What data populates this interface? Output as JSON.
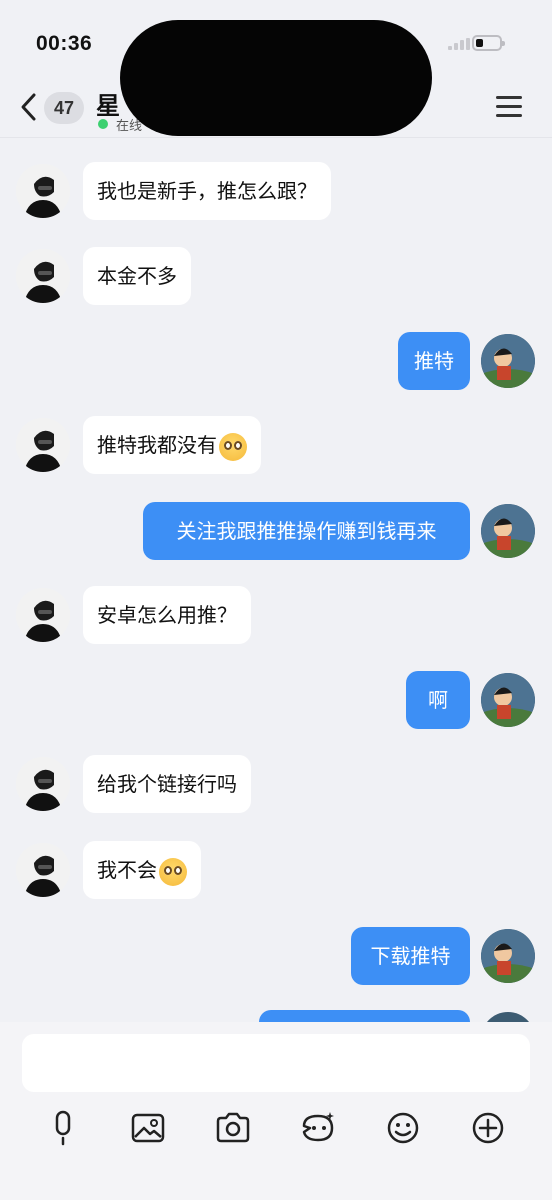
{
  "status_bar": {
    "time": "00:36",
    "battery_level": 0.3
  },
  "header": {
    "unread_count": "47",
    "contact_name": "星",
    "online_status": "在线"
  },
  "messages": [
    {
      "side": "peer",
      "text": "我也是新手，推怎么跟？"
    },
    {
      "side": "peer",
      "text": "本金不多"
    },
    {
      "side": "self",
      "text": "推特"
    },
    {
      "side": "peer",
      "text": "推特我都没有",
      "emoji": "pleading-face-emoji"
    },
    {
      "side": "self",
      "text": "关注我跟推推操作赚到钱再来"
    },
    {
      "side": "peer",
      "text": "安卓怎么用推？"
    },
    {
      "side": "self",
      "text": "啊"
    },
    {
      "side": "peer",
      "text": "给我个链接行吗"
    },
    {
      "side": "peer",
      "text": "我不会",
      "emoji": "flushed-sweat-emoji"
    },
    {
      "side": "self",
      "text": "下载推特"
    }
  ],
  "input": {
    "value": ""
  },
  "toolbar_icons": [
    "microphone-icon",
    "image-icon",
    "camera-icon",
    "sticker-icon",
    "emoji-icon",
    "plus-icon"
  ],
  "colors": {
    "self_bubble": "#3d8ff5",
    "peer_bubble": "#ffffff",
    "background": "#f0f1f5",
    "online": "#3cd070"
  }
}
